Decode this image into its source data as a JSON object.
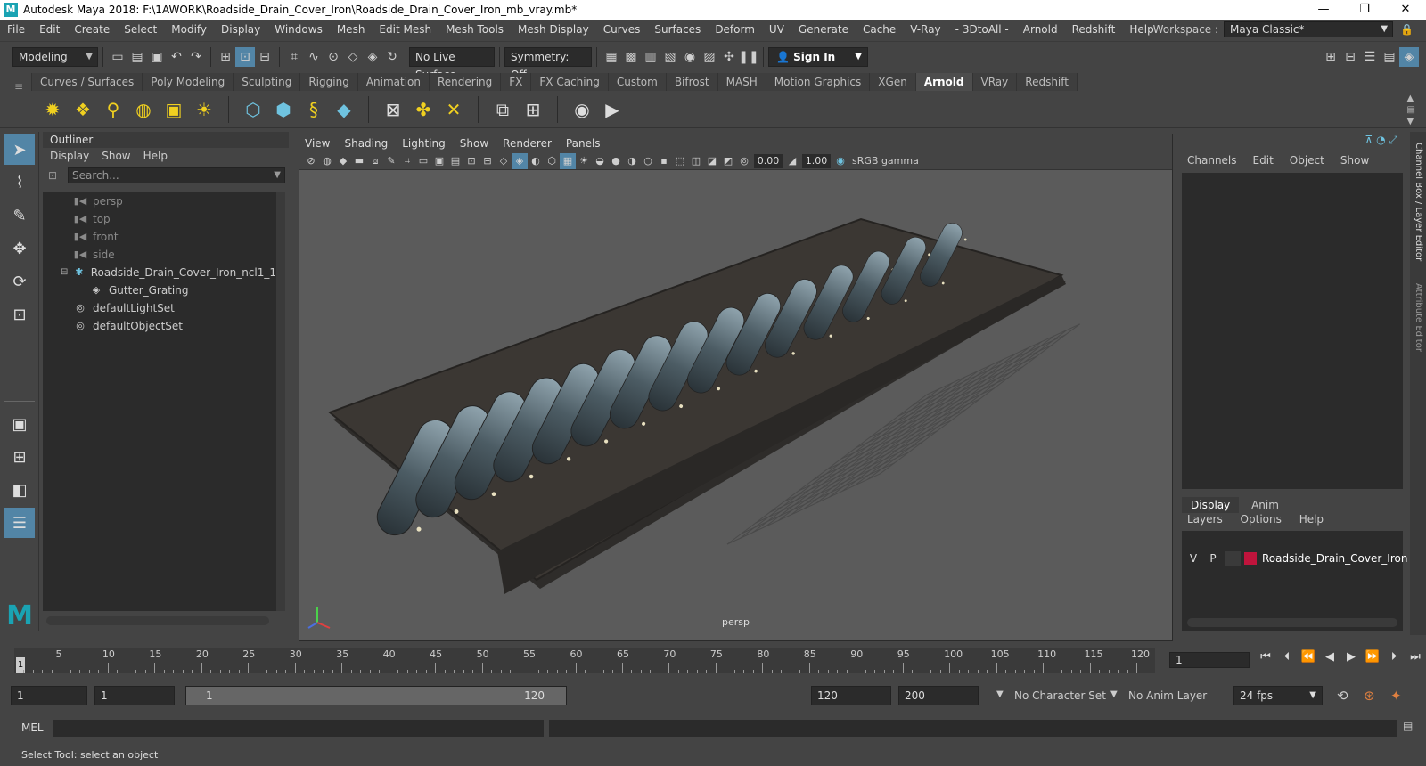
{
  "title_bar": {
    "logo": "M",
    "title": "Autodesk Maya 2018: F:\\1AWORK\\Roadside_Drain_Cover_Iron\\Roadside_Drain_Cover_Iron_mb_vray.mb*",
    "minimize": "—",
    "maximize": "❐",
    "close": "✕"
  },
  "menu": {
    "items": [
      "File",
      "Edit",
      "Create",
      "Select",
      "Modify",
      "Display",
      "Windows",
      "Mesh",
      "Edit Mesh",
      "Mesh Tools",
      "Mesh Display",
      "Curves",
      "Surfaces",
      "Deform",
      "UV",
      "Generate",
      "Cache",
      "V-Ray",
      "- 3DtoAll -",
      "Arnold",
      "Redshift",
      "Help"
    ],
    "workspace_label": "Workspace :",
    "workspace_value": "Maya Classic*"
  },
  "status_line": {
    "mode": "Modeling",
    "live_surface": "No Live Surface",
    "symmetry": "Symmetry: Off",
    "sign_in": "Sign In"
  },
  "shelf": {
    "tabs": [
      "Curves / Surfaces",
      "Poly Modeling",
      "Sculpting",
      "Rigging",
      "Animation",
      "Rendering",
      "FX",
      "FX Caching",
      "Custom",
      "Bifrost",
      "MASH",
      "Motion Graphics",
      "XGen",
      "Arnold",
      "VRay",
      "Redshift"
    ],
    "active_tab": "Arnold"
  },
  "outliner": {
    "title": "Outliner",
    "menu": [
      "Display",
      "Show",
      "Help"
    ],
    "search_placeholder": "Search...",
    "items": [
      {
        "label": "persp",
        "icon": "camera-icon",
        "dim": true,
        "indent": 1
      },
      {
        "label": "top",
        "icon": "camera-icon",
        "dim": true,
        "indent": 1
      },
      {
        "label": "front",
        "icon": "camera-icon",
        "dim": true,
        "indent": 1
      },
      {
        "label": "side",
        "icon": "camera-icon",
        "dim": true,
        "indent": 1
      },
      {
        "label": "Roadside_Drain_Cover_Iron_ncl1_1",
        "icon": "group-icon",
        "dim": false,
        "indent": 1
      },
      {
        "label": "Gutter_Grating",
        "icon": "mesh-icon",
        "dim": false,
        "indent": 2
      },
      {
        "label": "defaultLightSet",
        "icon": "set-icon",
        "dim": false,
        "indent": 1
      },
      {
        "label": "defaultObjectSet",
        "icon": "set-icon",
        "dim": false,
        "indent": 1
      }
    ]
  },
  "viewport": {
    "menu": [
      "View",
      "Shading",
      "Lighting",
      "Show",
      "Renderer",
      "Panels"
    ],
    "exposure": "0.00",
    "gamma": "1.00",
    "color_space": "sRGB gamma",
    "camera_label": "persp"
  },
  "channel_box": {
    "menu": [
      "Channels",
      "Edit",
      "Object",
      "Show"
    ],
    "layer_tabs": [
      "Display",
      "Anim"
    ],
    "layer_menu": [
      "Layers",
      "Options",
      "Help"
    ],
    "layer": {
      "v": "V",
      "p": "P",
      "name": "Roadside_Drain_Cover_Iron",
      "color": "#c0143c"
    },
    "side_tab_1": "Channel Box / Layer Editor",
    "side_tab_2": "Attribute Editor"
  },
  "time_slider": {
    "ticks": [
      5,
      10,
      15,
      20,
      25,
      30,
      35,
      40,
      45,
      50,
      55,
      60,
      65,
      70,
      75,
      80,
      85,
      90,
      95,
      100,
      105,
      110,
      115,
      120
    ],
    "start_marker": "1",
    "current_frame": "1"
  },
  "range": {
    "start": "1",
    "playback_start": "1",
    "range_start": "1",
    "range_end": "120",
    "playback_end": "120",
    "end": "200",
    "character_set": "No Character Set",
    "anim_layer": "No Anim Layer",
    "fps": "24 fps"
  },
  "command_line": {
    "label": "MEL"
  },
  "help_line": {
    "text": "Select Tool: select an object"
  }
}
